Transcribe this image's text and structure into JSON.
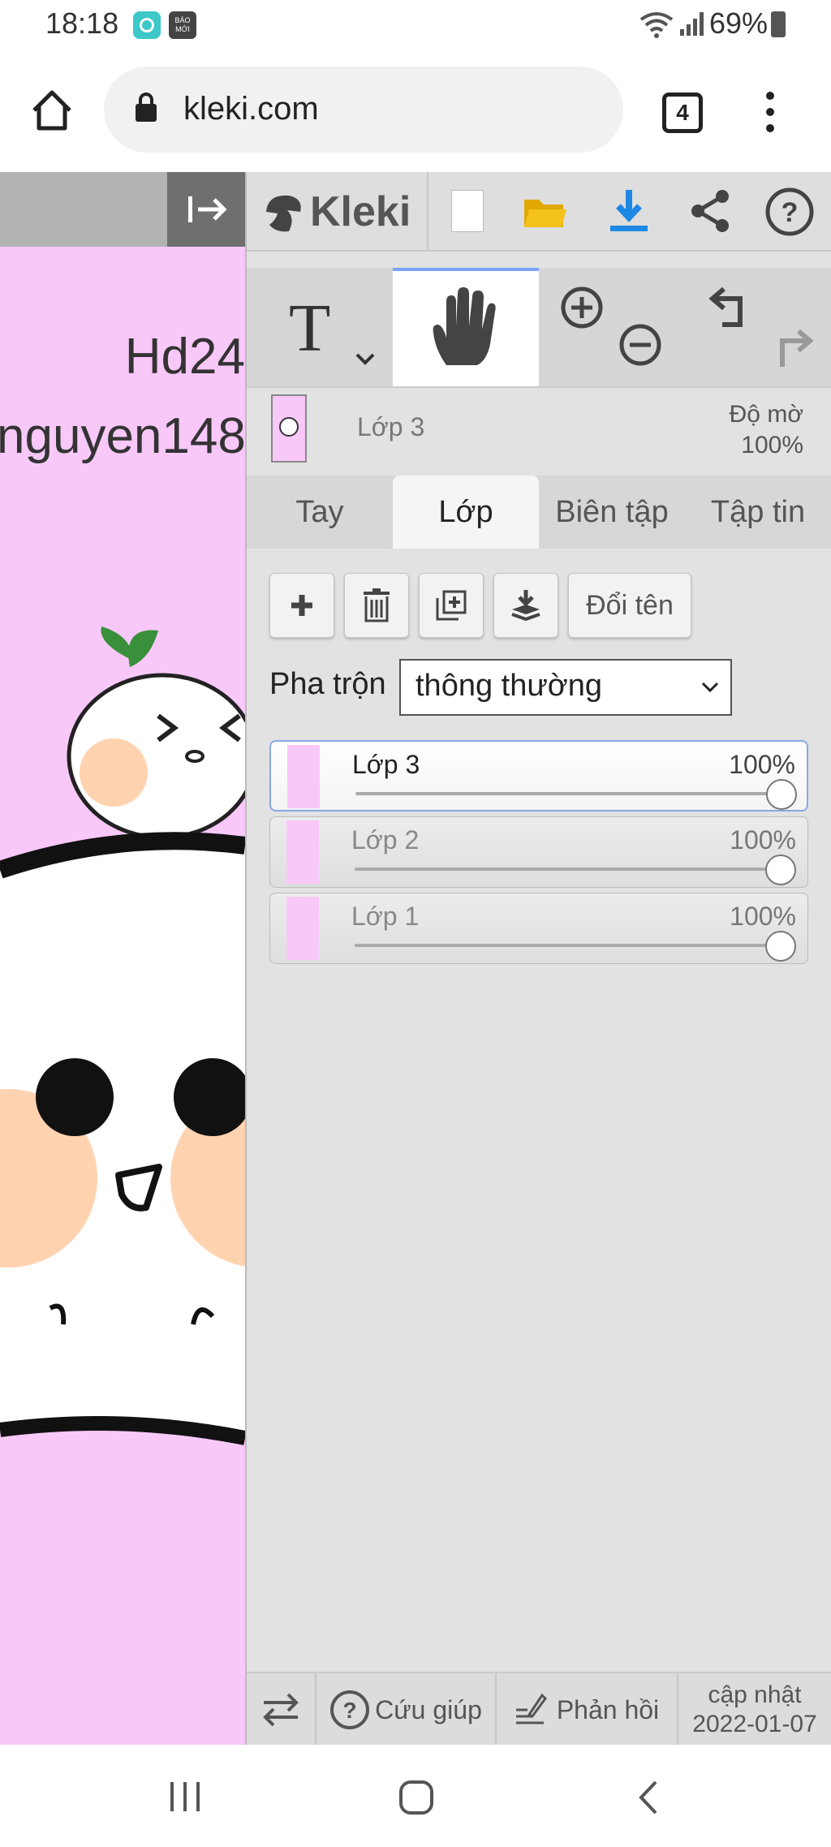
{
  "status_bar": {
    "time": "18:18",
    "battery": "69%",
    "app_badge": "BÁO MỚI",
    "icons": [
      "app-notification-icon",
      "wifi-icon",
      "signal-icon",
      "battery-icon"
    ]
  },
  "browser": {
    "url": "kleki.com",
    "tab_count": "4",
    "icons": [
      "home-icon",
      "lock-icon",
      "menu-dots-icon"
    ]
  },
  "canvas": {
    "text_line1": "Hd24",
    "text_line2": "nguyen148",
    "background": "#f8c8f8"
  },
  "app": {
    "name": "Kleki",
    "toolbar_icons": [
      "new-image-icon",
      "open-folder-icon",
      "download-icon",
      "share-icon",
      "help-icon"
    ]
  },
  "tools": {
    "text_tool": "T",
    "active_tool": "hand-tool",
    "zoom_icons": [
      "zoom-in-icon",
      "zoom-out-icon"
    ],
    "history_icons": [
      "undo-icon",
      "redo-icon"
    ]
  },
  "current_layer": {
    "name": "Lớp 3",
    "opacity_label": "Độ mờ",
    "opacity_value": "100%"
  },
  "tabs": [
    {
      "label": "Tay"
    },
    {
      "label": "Lớp",
      "active": true
    },
    {
      "label": "Biên tập"
    },
    {
      "label": "Tập tin"
    }
  ],
  "layer_actions": {
    "rename_label": "Đổi tên",
    "icons": [
      "add-layer-icon",
      "delete-layer-icon",
      "duplicate-layer-icon",
      "merge-down-icon"
    ]
  },
  "blend": {
    "label": "Pha trộn",
    "selected": "thông thường"
  },
  "layers": [
    {
      "name": "Lớp 3",
      "opacity": "100%",
      "selected": true,
      "opacity_value": 1.0
    },
    {
      "name": "Lớp 2",
      "opacity": "100%",
      "selected": false,
      "opacity_value": 1.0
    },
    {
      "name": "Lớp 1",
      "opacity": "100%",
      "selected": false,
      "opacity_value": 1.0
    }
  ],
  "bottom_bar": {
    "help_label": "Cứu giúp",
    "feedback_label": "Phản hồi",
    "update_label": "cập nhật",
    "update_date": "2022-01-07"
  },
  "colors": {
    "accent_blue": "#1e88e5",
    "folder_yellow": "#f4b400",
    "canvas_pink": "#f8c8f8",
    "panel_gray": "#e2e2e2"
  }
}
